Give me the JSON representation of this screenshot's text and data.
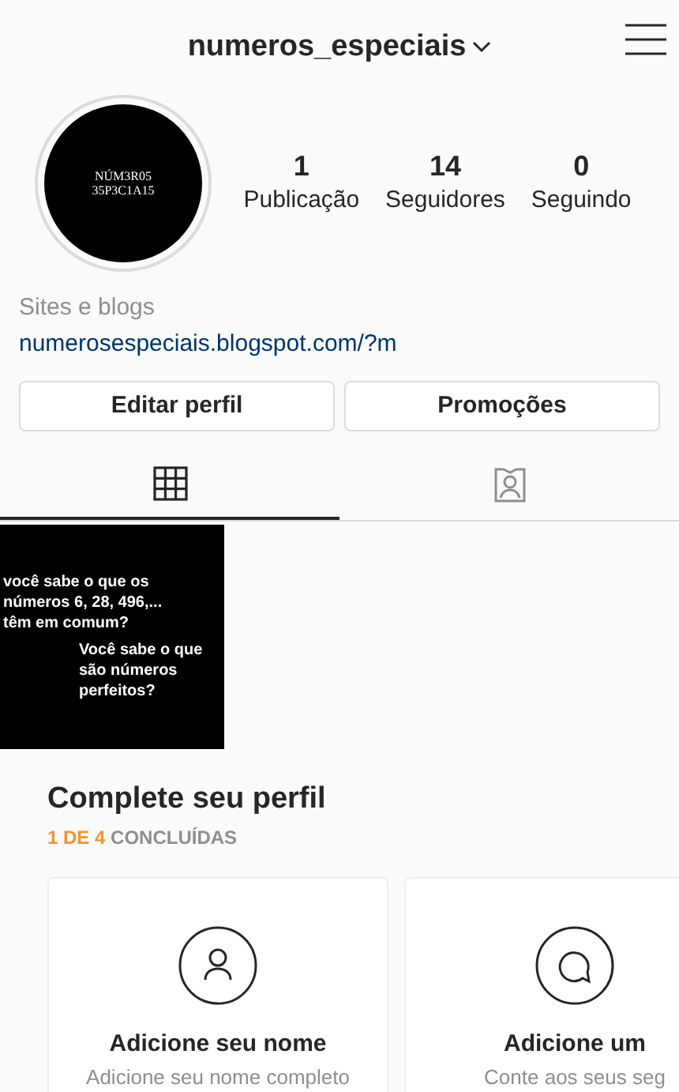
{
  "header": {
    "username": "numeros_especiais"
  },
  "profile": {
    "avatar_text": "NÚM3R05 35P3C1A15",
    "stats": [
      {
        "value": "1",
        "label": "Publicação"
      },
      {
        "value": "14",
        "label": "Seguidores"
      },
      {
        "value": "0",
        "label": "Seguindo"
      }
    ],
    "category": "Sites e blogs",
    "link": "numerosespeciais.blogspot.com/?m"
  },
  "buttons": [
    "Editar perfil",
    "Promoções"
  ],
  "tabs": [
    {
      "kind": "grid",
      "selected": true
    },
    {
      "kind": "tagged",
      "selected": false
    }
  ],
  "posts": [
    {
      "lines": [
        "você sabe o que os números 6, 28, 496,... têm em comum?",
        "Você sabe o que são números perfeitos?"
      ]
    }
  ],
  "complete_profile": {
    "title": "Complete seu perfil",
    "progress": "1 DE 4",
    "progress_suffix": "CONCLUÍDAS",
    "cards": [
      {
        "kind": "person",
        "title": "Adicione seu nome",
        "subtitle": "Adicione seu nome completo"
      },
      {
        "kind": "chat",
        "title": "Adicione um",
        "subtitle": "Conte aos seus seg"
      }
    ]
  }
}
